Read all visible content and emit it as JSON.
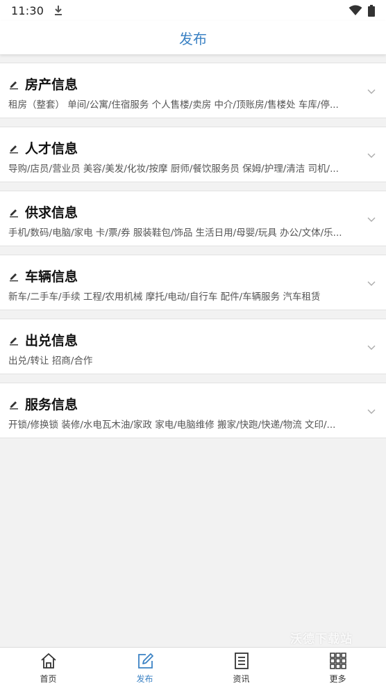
{
  "status_bar": {
    "time": "11:30",
    "icons": [
      "download-icon",
      "wifi-icon",
      "battery-icon"
    ]
  },
  "header": {
    "title": "发布"
  },
  "colors": {
    "accent": "#3b82c4",
    "background": "#f2f2f2"
  },
  "categories": [
    {
      "title": "房产信息",
      "desc": "租房（整套） 单间/公寓/住宿服务 个人售楼/卖房 中介/顶账房/售楼处 车库/停..."
    },
    {
      "title": "人才信息",
      "desc": "导购/店员/营业员 美容/美发/化妆/按摩 厨师/餐饮服务员 保姆/护理/清洁 司机/..."
    },
    {
      "title": "供求信息",
      "desc": "手机/数码/电脑/家电 卡/票/券 服装鞋包/饰品 生活日用/母婴/玩具 办公/文体/乐..."
    },
    {
      "title": "车辆信息",
      "desc": "新车/二手车/手续 工程/农用机械 摩托/电动/自行车 配件/车辆服务 汽车租赁"
    },
    {
      "title": "出兑信息",
      "desc": "出兑/转让 招商/合作"
    },
    {
      "title": "服务信息",
      "desc": "开锁/修换锁 装修/水电瓦木油/家政 家电/电脑维修 搬家/快跑/快递/物流 文印/..."
    }
  ],
  "watermark": "沃德下载站",
  "tabbar": {
    "items": [
      {
        "label": "首页",
        "icon": "home-icon",
        "active": false
      },
      {
        "label": "发布",
        "icon": "edit-icon",
        "active": true
      },
      {
        "label": "资讯",
        "icon": "news-icon",
        "active": false
      },
      {
        "label": "更多",
        "icon": "grid-icon",
        "active": false
      }
    ]
  }
}
